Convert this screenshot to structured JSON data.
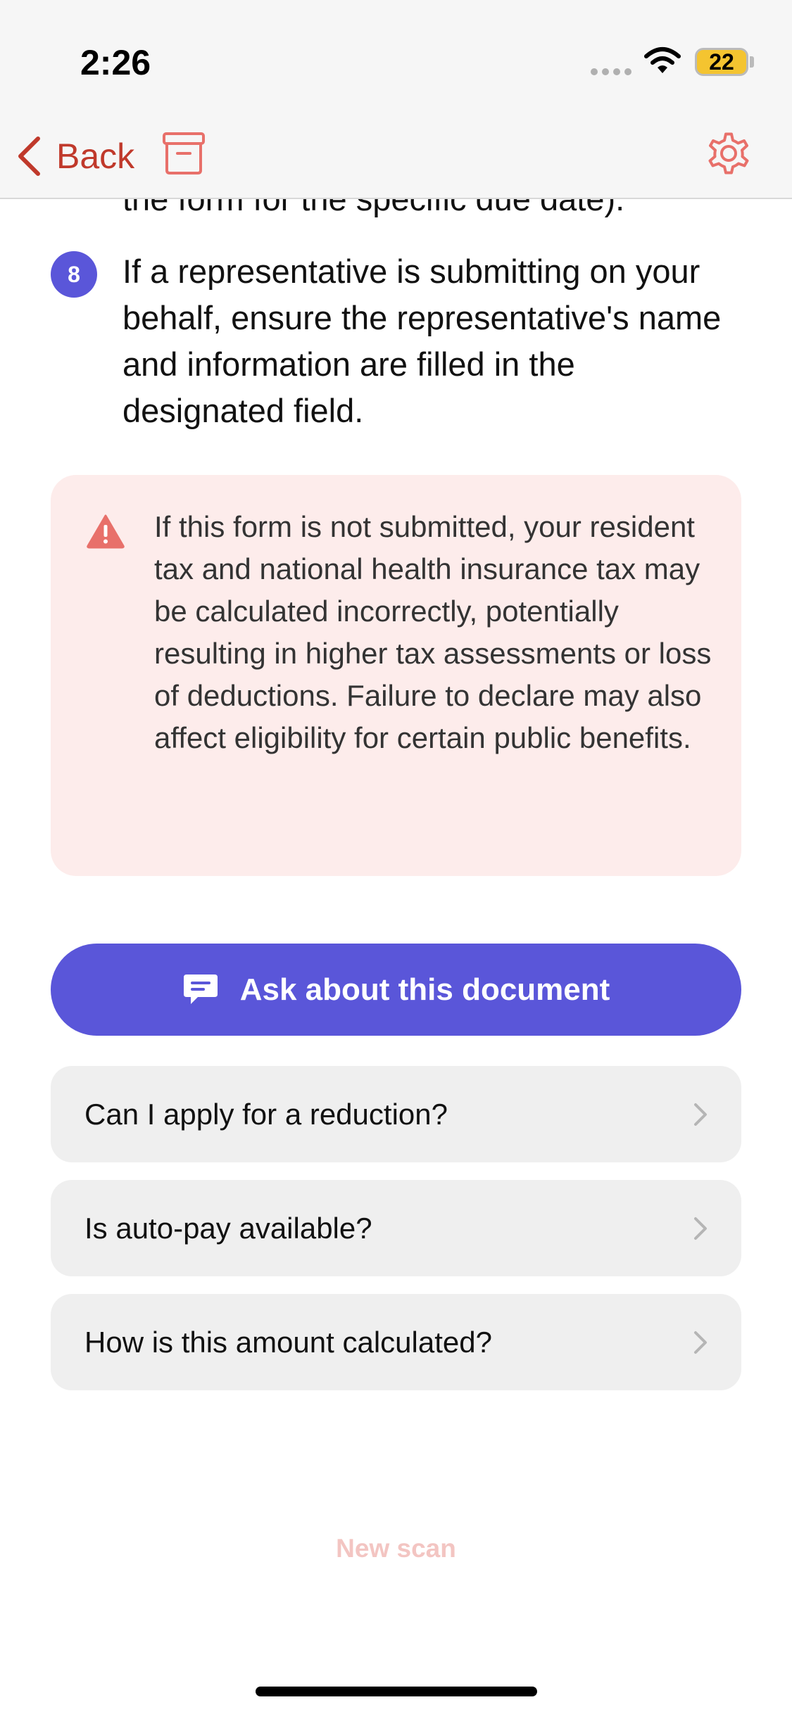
{
  "status_bar": {
    "time": "2:26",
    "battery_level": "22"
  },
  "nav": {
    "back_label": "Back",
    "accent_color": "#c0392b"
  },
  "steps": {
    "previous_partial_text": "the form for the specific due date).",
    "current": {
      "number": "8",
      "text": "If a representative is submitting on your behalf, ensure the representative's name and information are filled in the designated field."
    }
  },
  "warning": {
    "icon": "warning-triangle-icon",
    "text": "If this form is not submitted, your resident tax and national health insurance tax may be calculated incorrectly, potentially resulting in higher tax assessments or loss of deductions. Failure to declare may also affect eligibility for certain public benefits."
  },
  "ask": {
    "label": "Ask about this document",
    "color": "#5a56d9"
  },
  "suggestions": [
    {
      "label": "Can I apply for a reduction?"
    },
    {
      "label": "Is auto-pay available?"
    },
    {
      "label": "How is this amount calculated?"
    }
  ],
  "new_scan_label": "New scan"
}
